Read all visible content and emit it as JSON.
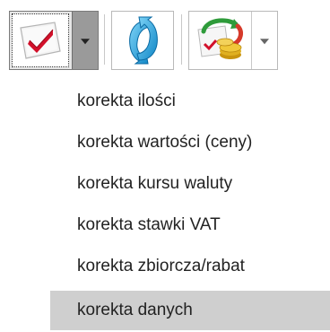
{
  "toolbar": {
    "buttons": [
      {
        "icon": "checkmark-icon",
        "has_dropdown": true,
        "state": "pressed"
      },
      {
        "icon": "refresh-icon",
        "has_dropdown": false
      },
      {
        "icon": "coins-exchange-icon",
        "has_dropdown": true
      }
    ],
    "colors": {
      "check_red": "#d2102a",
      "refresh_blue": "#1aa3e0",
      "arrow_green": "#2e9b3a",
      "arrow_red": "#d63a2a",
      "coin_gold": "#e0b020"
    }
  },
  "menu": {
    "items": [
      {
        "label": "korekta ilości"
      },
      {
        "label": "korekta wartości (ceny)"
      },
      {
        "label": "korekta kursu waluty"
      },
      {
        "label": "korekta stawki VAT"
      },
      {
        "label": "korekta zbiorcza/rabat"
      },
      {
        "label": "korekta danych"
      }
    ],
    "selected_label": "korekta danych",
    "selected_color": "#cfcfcf"
  }
}
